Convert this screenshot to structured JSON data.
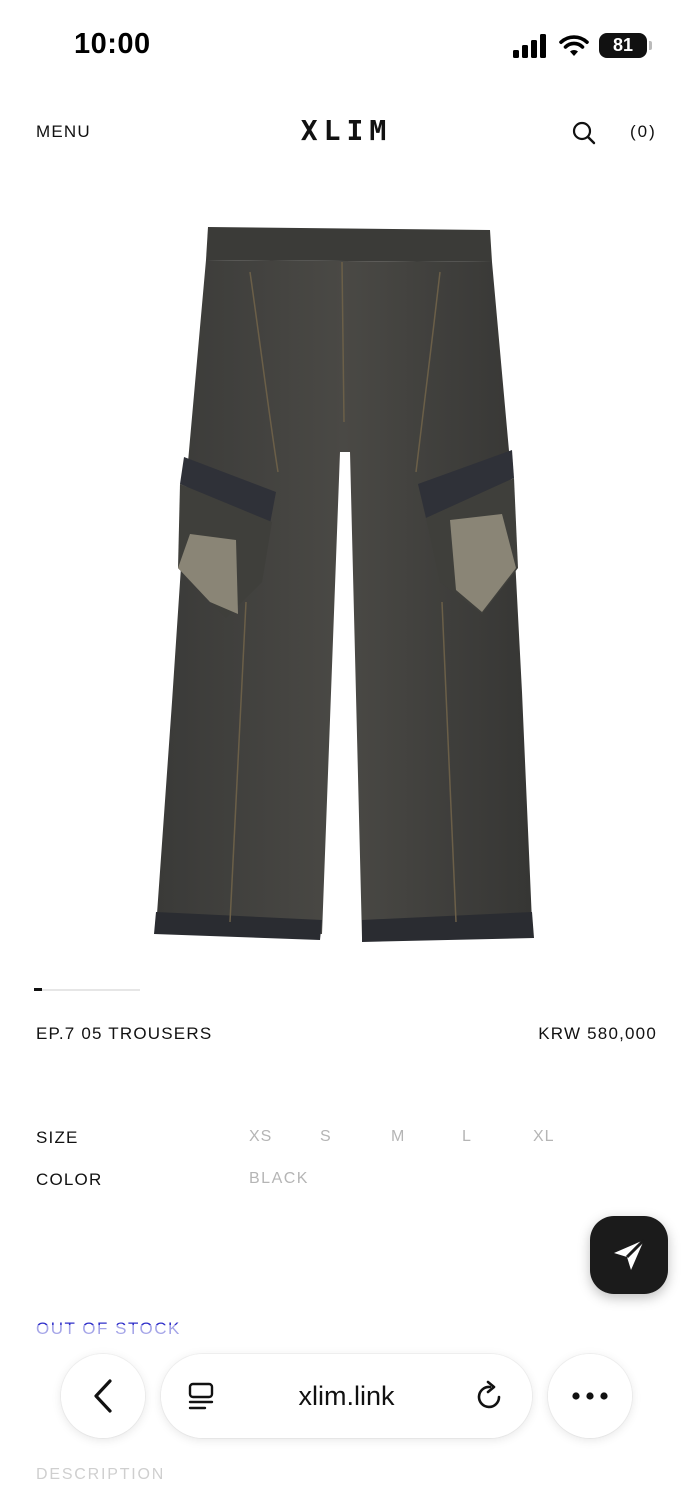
{
  "status_bar": {
    "time": "10:00",
    "battery": "81"
  },
  "header": {
    "menu_label": "MENU",
    "logo": "XLIM",
    "cart_label": "(0)"
  },
  "gallery": {
    "progress_fraction": 0.08
  },
  "product": {
    "name": "EP.7 05 TROUSERS",
    "price": "KRW 580,000",
    "size_label": "SIZE",
    "sizes": [
      "XS",
      "S",
      "M",
      "L",
      "XL"
    ],
    "color_label": "COLOR",
    "color_value": "BLACK",
    "status": "OUT OF STOCK",
    "description_label": "DESCRIPTION"
  },
  "browser": {
    "url": "xlim.link"
  },
  "colors": {
    "accent_blue": "#2f2fc9",
    "muted_text": "#b5b5b5",
    "fab_bg": "#1b1b1b"
  },
  "icons": [
    "cellular-signal-icon",
    "wifi-icon",
    "battery-icon",
    "search-icon",
    "send-icon",
    "chevron-left-icon",
    "reader-icon",
    "reload-icon",
    "more-dots-icon"
  ]
}
